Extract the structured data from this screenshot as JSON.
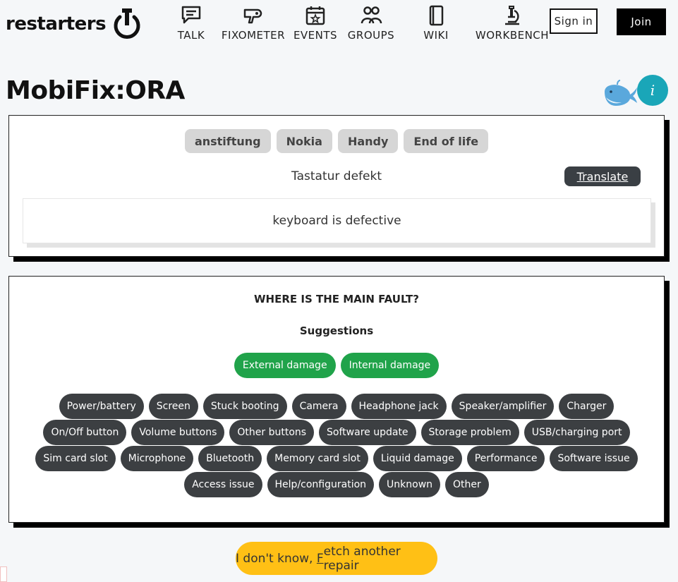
{
  "brand": {
    "name": "restarters"
  },
  "nav": [
    {
      "key": "talk",
      "label": "TALK"
    },
    {
      "key": "fixometer",
      "label": "FIXOMETER"
    },
    {
      "key": "events",
      "label": "EVENTS"
    },
    {
      "key": "groups",
      "label": "GROUPS"
    },
    {
      "key": "wiki",
      "label": "WIKI"
    },
    {
      "key": "workbench",
      "label": "WORKBENCH"
    }
  ],
  "auth": {
    "signin_label": "Sign in",
    "join_label": "Join"
  },
  "page": {
    "title": "MobiFix:ORA",
    "info_label": "i"
  },
  "problem": {
    "tags": [
      "anstiftung",
      "Nokia",
      "Handy",
      "End of life"
    ],
    "original_text": "Tastatur defekt",
    "translate_label": "Translate",
    "translated_text": "keyboard is defective"
  },
  "fault": {
    "heading": "WHERE IS THE MAIN FAULT?",
    "suggestions_heading": "Suggestions",
    "suggestions": [
      "External damage",
      "Internal damage"
    ],
    "rows": [
      [
        "Power/battery",
        "Screen",
        "Stuck booting",
        "Camera",
        "Headphone jack",
        "Speaker/amplifier",
        "Charger"
      ],
      [
        "On/Off button",
        "Volume buttons",
        "Other buttons",
        "Software update",
        "Storage problem",
        "USB/charging port"
      ],
      [
        "Sim card slot",
        "Microphone",
        "Bluetooth",
        "Memory card slot",
        "Liquid damage",
        "Performance",
        "Software issue"
      ],
      [
        "Access issue",
        "Help/configuration",
        "Unknown",
        "Other"
      ]
    ]
  },
  "fetch": {
    "prefix": "I don't know, ",
    "accesskey": "F",
    "suffix": "etch another repair"
  },
  "colors": {
    "suggestion": "#20a34a",
    "fault_button": "#3c3f42",
    "info": "#1aa6b8",
    "fetch": "#ffc015",
    "tag": "#d6d6d6"
  }
}
